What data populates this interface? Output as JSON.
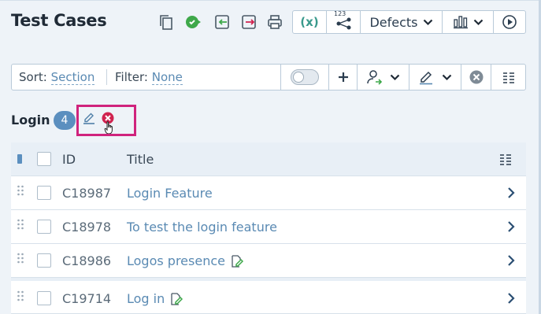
{
  "header": {
    "title": "Test Cases",
    "defects_label": "Defects",
    "formula_label": "(x)",
    "badge_123": "123"
  },
  "toolbar": {
    "sort_label": "Sort:",
    "sort_value": "Section",
    "filter_label": "Filter:",
    "filter_value": "None"
  },
  "group": {
    "name": "Login",
    "count": "4"
  },
  "table": {
    "columns": {
      "id": "ID",
      "title": "Title"
    },
    "rows": [
      {
        "id": "C18987",
        "title": "Login Feature",
        "edit_icon": false
      },
      {
        "id": "C18978",
        "title": "To test the login feature",
        "edit_icon": false
      },
      {
        "id": "C18986",
        "title": "Logos presence",
        "edit_icon": true
      },
      {
        "id": "C19714",
        "title": "Log in",
        "edit_icon": true
      }
    ]
  },
  "colors": {
    "accent": "#5a8ab3",
    "badge": "#5b8fbf",
    "highlight": "#d0237d",
    "delete": "#d0234f",
    "green": "#3ea84a"
  }
}
